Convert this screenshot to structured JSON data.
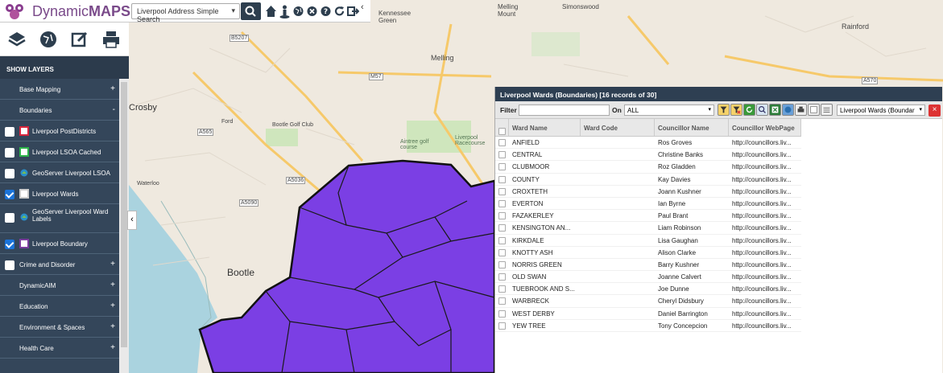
{
  "app": {
    "brand_dynamic": "Dynamic",
    "brand_maps": "MAPS"
  },
  "search": {
    "selected": "Liverpool Address Simple Search"
  },
  "header_icons": [
    "search-icon",
    "home-icon",
    "person-location-icon",
    "globe-icon",
    "close-circle-icon",
    "help-icon",
    "refresh-icon",
    "logout-icon"
  ],
  "sidebar": {
    "tools": [
      "layers-icon",
      "globe-icon",
      "edit-icon",
      "print-icon"
    ],
    "layers_label": "SHOW LAYERS",
    "rows": [
      {
        "label": "Base Mapping",
        "type": "group",
        "expander": "+"
      },
      {
        "label": "Boundaries",
        "type": "group",
        "expander": "-"
      },
      {
        "label": "Liverpool PostDistricts",
        "type": "layer",
        "checked": false,
        "swatch": "#d7263d"
      },
      {
        "label": "Liverpool LSOA Cached",
        "type": "layer",
        "checked": false,
        "swatch": "#2db34a"
      },
      {
        "label": "GeoServer Liverpool LSOA",
        "type": "geoserver",
        "checked": false
      },
      {
        "label": "Liverpool Wards",
        "type": "layer",
        "checked": true,
        "swatch": "#cccccc"
      },
      {
        "label": "GeoServer Liverpool Ward Labels",
        "type": "geoserver",
        "checked": false,
        "tall": true
      },
      {
        "label": "Liverpool Boundary",
        "type": "layer",
        "checked": true,
        "swatch": "#7a3e9d"
      },
      {
        "label": "Crime and Disorder",
        "type": "group-cb",
        "checked": false,
        "expander": "+"
      },
      {
        "label": "DynamicAIM",
        "type": "group",
        "expander": "+"
      },
      {
        "label": "Education",
        "type": "group",
        "expander": "+"
      },
      {
        "label": "Environment & Spaces",
        "type": "group",
        "expander": "+"
      },
      {
        "label": "Health Care",
        "type": "group",
        "expander": "+"
      }
    ]
  },
  "map": {
    "labels": [
      "Crosby",
      "Ford",
      "Bootle Golf Club",
      "Waterloo",
      "Bootle",
      "Melling",
      "Kennessee Green",
      "Melling Mount",
      "Simonswood",
      "Rainford",
      "Aintree golf course",
      "Liverpool Racecourse",
      "B5207",
      "A565",
      "A5036",
      "A5090",
      "A570",
      "M57"
    ],
    "fill_color": "#7b3fe4"
  },
  "panel": {
    "title": "Liverpool Wards (Boundaries) [16 records of 30]",
    "filter_label": "Filter",
    "filter_value": "",
    "on_label": "On",
    "on_value": "ALL",
    "layer_value": "Liverpool Wards (Boundar",
    "tools": [
      "filter-icon",
      "clear-filter-icon",
      "refresh-icon",
      "zoom-icon",
      "export-excel-icon",
      "globe-icon",
      "print-icon",
      "clear-icon",
      "grid-icon"
    ],
    "close": "×",
    "columns": [
      "Ward Name",
      "Ward Code",
      "Councillor Name",
      "Councillor WebPage"
    ],
    "rows": [
      [
        "ANFIELD",
        "",
        "Ros Groves",
        "http://councillors.liv..."
      ],
      [
        "CENTRAL",
        "",
        "Christine Banks",
        "http://councillors.liv..."
      ],
      [
        "CLUBMOOR",
        "",
        "Roz Gladden",
        "http://councillors.liv..."
      ],
      [
        "COUNTY",
        "",
        "Kay Davies",
        "http://councillors.liv..."
      ],
      [
        "CROXTETH",
        "",
        "Joann Kushner",
        "http://councillors.liv..."
      ],
      [
        "EVERTON",
        "",
        "Ian Byrne",
        "http://councillors.liv..."
      ],
      [
        "FAZAKERLEY",
        "",
        "Paul Brant",
        "http://councillors.liv..."
      ],
      [
        "KENSINGTON AN...",
        "",
        "Liam Robinson",
        "http://councillors.liv..."
      ],
      [
        "KIRKDALE",
        "",
        "Lisa Gaughan",
        "http://councillors.liv..."
      ],
      [
        "KNOTTY ASH",
        "",
        "Alison Clarke",
        "http://councillors.liv..."
      ],
      [
        "NORRIS GREEN",
        "",
        "Barry Kushner",
        "http://councillors.liv..."
      ],
      [
        "OLD SWAN",
        "",
        "Joanne Calvert",
        "http://councillors.liv..."
      ],
      [
        "TUEBROOK AND S...",
        "",
        "Joe Dunne",
        "http://councillors.liv..."
      ],
      [
        "WARBRECK",
        "",
        "Cheryl Didsbury",
        "http://councillors.liv..."
      ],
      [
        "WEST DERBY",
        "",
        "Daniel Barrington",
        "http://councillors.liv..."
      ],
      [
        "YEW TREE",
        "",
        "Tony Concepcion",
        "http://councillors.liv..."
      ]
    ]
  }
}
